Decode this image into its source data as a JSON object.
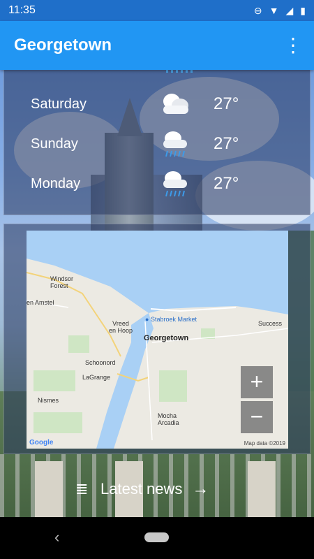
{
  "status_bar": {
    "time": "11:35",
    "icons": [
      "dnd-icon",
      "wifi-icon",
      "signal-icon",
      "battery-icon"
    ]
  },
  "app_bar": {
    "title": "Georgetown",
    "menu_icon": "more-vert-icon"
  },
  "forecast": {
    "rows": [
      {
        "day": "Saturday",
        "icon": "cloudy-icon",
        "temp": "27°"
      },
      {
        "day": "Sunday",
        "icon": "rain-icon",
        "temp": "27°"
      },
      {
        "day": "Monday",
        "icon": "rain-icon",
        "temp": "27°"
      }
    ]
  },
  "map": {
    "labels": {
      "windsor_forest": "Windsor\nForest",
      "en_amstel": "en Amstel",
      "vreed_en_hoop": "Vreed\nen Hoop",
      "stabroek_market": "Stabroek Market",
      "success": "Success",
      "georgetown": "Georgetown",
      "schoonord": "Schoonord",
      "lagrange": "LaGrange",
      "nismes": "Nismes",
      "mocha_arcadia": "Mocha\nArcadia"
    },
    "zoom_in": "+",
    "zoom_out": "−",
    "attribution_logo": "Google",
    "attribution": "Map data ©2019"
  },
  "news": {
    "label": "Latest news",
    "list_icon": "list-icon",
    "arrow_icon": "arrow-right-icon"
  },
  "colors": {
    "status_bar": "#1f6fc9",
    "app_bar": "#2196f3",
    "water": "#a9d0f5"
  }
}
